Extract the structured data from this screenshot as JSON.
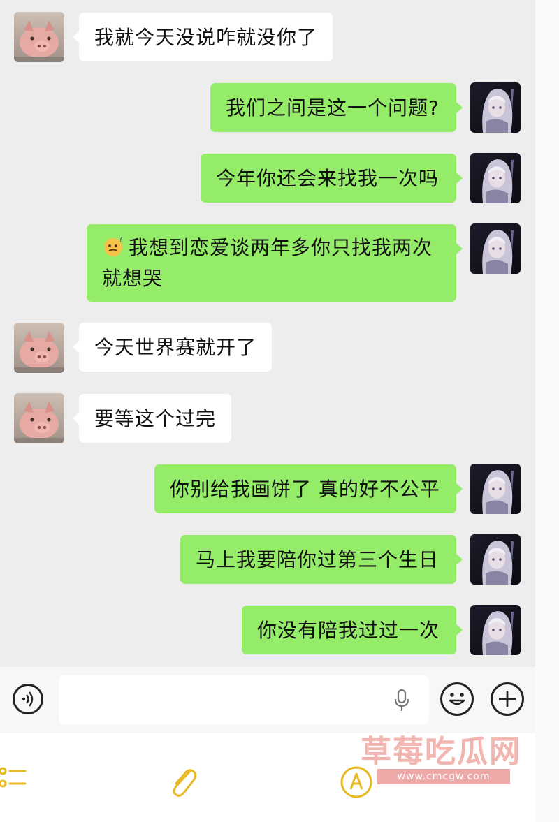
{
  "messages": [
    {
      "side": "in",
      "text": "我就今天没说咋就没你了"
    },
    {
      "side": "out",
      "text": "我们之间是这一个问题?"
    },
    {
      "side": "out",
      "text": "今年你还会来找我一次吗"
    },
    {
      "side": "out",
      "emoji": "thinking-face",
      "line1": "我想到恋爱谈两年多你只找我两次",
      "line2": "就想哭"
    },
    {
      "side": "in",
      "text": "今天世界赛就开了"
    },
    {
      "side": "in",
      "text": "要等这个过完"
    },
    {
      "side": "out",
      "text": "你别给我画饼了 真的好不公平"
    },
    {
      "side": "out",
      "text": "马上我要陪你过第三个生日"
    },
    {
      "side": "out",
      "text": "你没有陪我过过一次"
    }
  ],
  "input": {
    "placeholder": "",
    "icons": [
      "voice-toggle-icon",
      "microphone-icon",
      "emoji-icon",
      "plus-icon"
    ]
  },
  "bottom_icons": [
    "list-icon",
    "paperclip-icon",
    "compass-icon"
  ],
  "watermark": {
    "title": "草莓吃瓜网",
    "url": "www.cmcgw.com"
  },
  "colors": {
    "chat_background": "#ededed",
    "outgoing_bubble": "#95ec69",
    "incoming_bubble": "#ffffff",
    "bottom_icon_accent": "#e8b923"
  }
}
